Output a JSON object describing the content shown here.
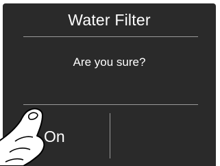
{
  "dialog": {
    "title": "Water Filter",
    "message": "Are you sure?",
    "confirm_label": "On",
    "cancel_label": ""
  },
  "colors": {
    "screen_background": "#2a2a2a",
    "text": "#ffffff",
    "divider": "#9a9a9a"
  },
  "icons": {
    "pointer": "pointing-hand-icon"
  }
}
